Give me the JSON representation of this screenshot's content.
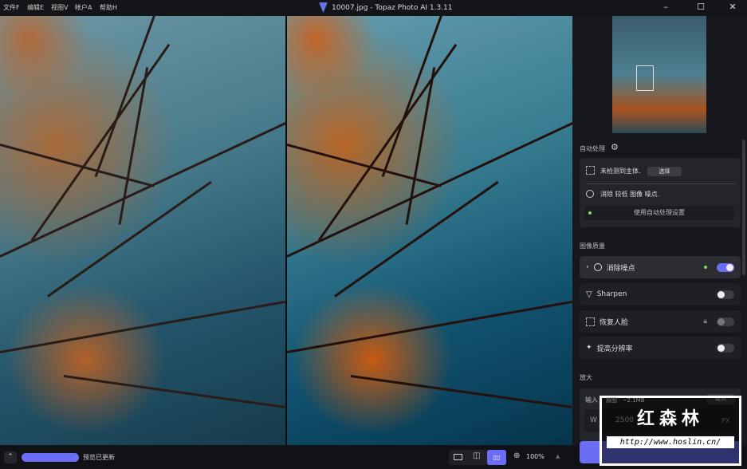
{
  "menu": [
    "文件F",
    "编辑E",
    "视图V",
    "帐户A",
    "帮助H"
  ],
  "window": {
    "title": "10007.jpg - Topaz Photo AI 1.3.11",
    "minimize": "–",
    "maximize": "☐",
    "close": "✕"
  },
  "auto": {
    "heading": "自动处理",
    "subject_text": "未检测到主体.",
    "select_btn": "选择",
    "noise_text": "消除 较低 图像 噪点.",
    "apply_btn": "使用自动处理设置"
  },
  "quality": {
    "heading": "图像质量",
    "items": [
      {
        "label": "消除噪点",
        "enabled": true
      },
      {
        "label": "Sharpen",
        "enabled": false
      },
      {
        "label": "恢复人脸",
        "enabled": false,
        "locked": true
      },
      {
        "label": "提高分辨率",
        "enabled": false
      }
    ]
  },
  "upscale": {
    "heading": "放大",
    "input_label": "输入",
    "input_info": "原图 · ~2.1MB",
    "crop_btn": "裁剪",
    "w_label": "W",
    "width_value": "2500",
    "unit": "PX"
  },
  "bottom": {
    "status": "预览已更新",
    "zoom": "100%",
    "view_mode": "side-by-side"
  },
  "watermark": {
    "logo_text": "红森林",
    "url": "http://www.hoslin.cn/"
  },
  "colors": {
    "accent": "#6b6ef5",
    "active_dot": "#7ed957"
  }
}
